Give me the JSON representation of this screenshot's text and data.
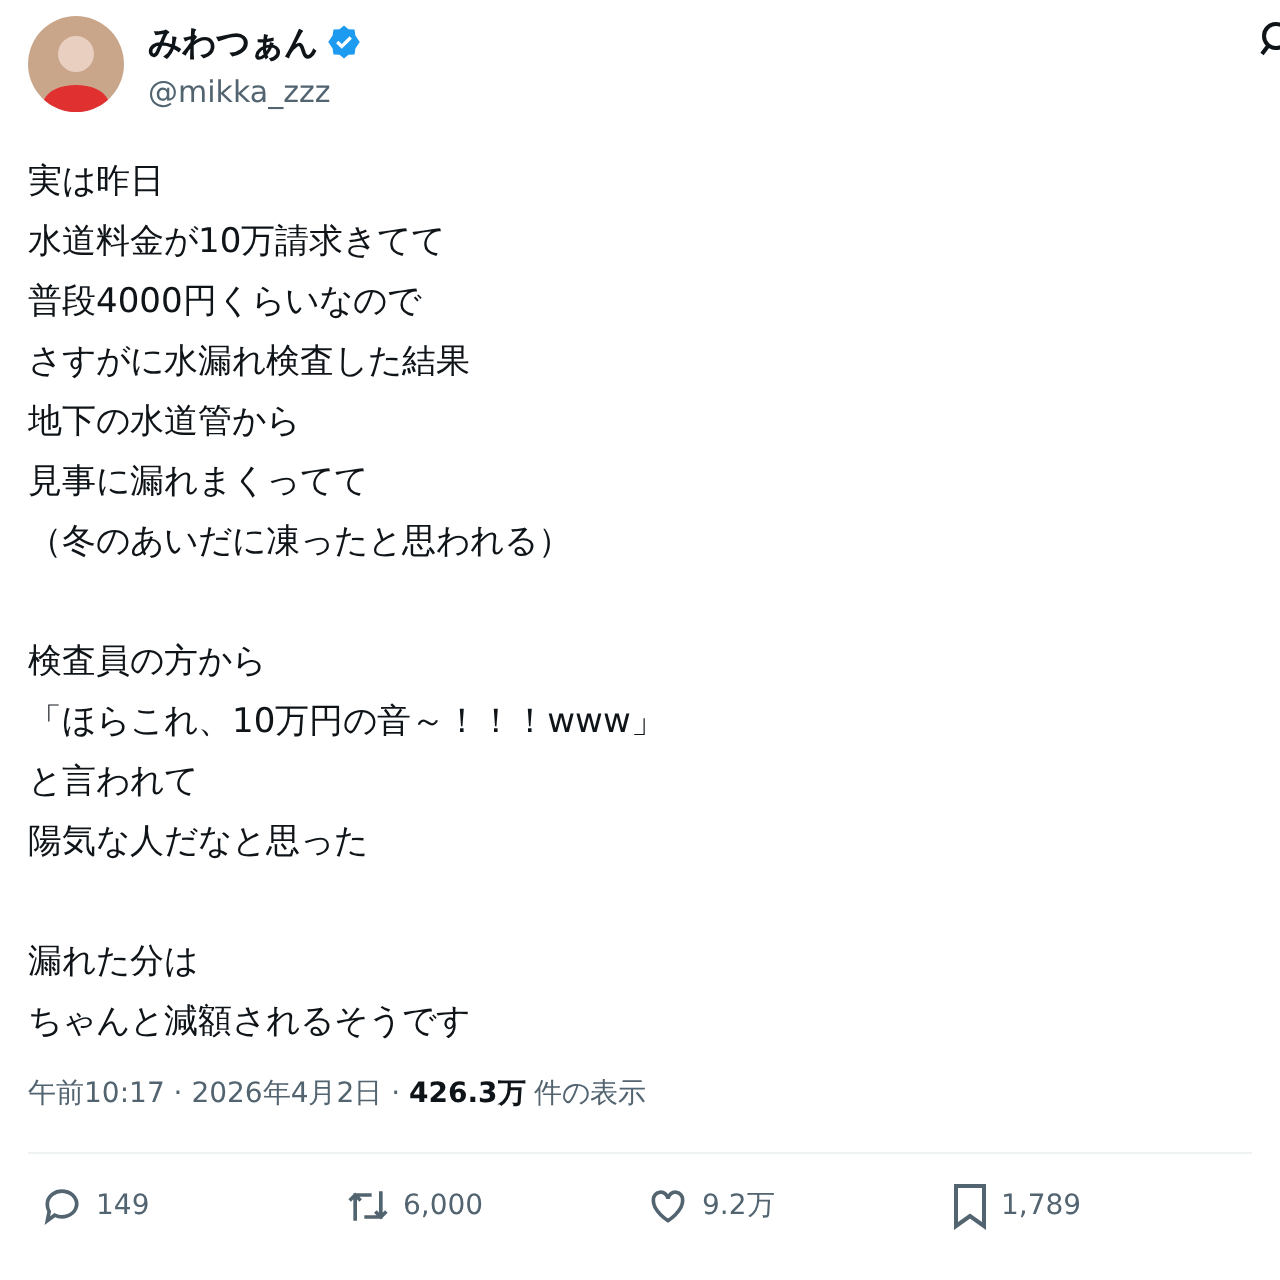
{
  "author": {
    "name": "みわつぁん",
    "verified": true,
    "handle": "@mikka_zzz"
  },
  "paragraphs": [
    [
      "実は昨日",
      "水道料金が10万請求きてて",
      "普段4000円くらいなので",
      "さすがに水漏れ検査した結果",
      "地下の水道管から",
      "見事に漏れまくってて",
      "（冬のあいだに凍ったと思われる）"
    ],
    [
      "検査員の方から",
      "「ほらこれ、10万円の音～！！！www」",
      "と言われて",
      "陽気な人だなと思った"
    ],
    [
      "漏れた分は",
      "ちゃんと減額されるそうです"
    ]
  ],
  "meta": "午前10:17 · 2026年4月2日 · **426.3万** 件の表示",
  "actions": [
    {
      "kind": "reply",
      "count": "149"
    },
    {
      "kind": "repost",
      "count": "6,000"
    },
    {
      "kind": "like",
      "count": "9.2万"
    },
    {
      "kind": "bookmark",
      "count": "1,789"
    }
  ]
}
